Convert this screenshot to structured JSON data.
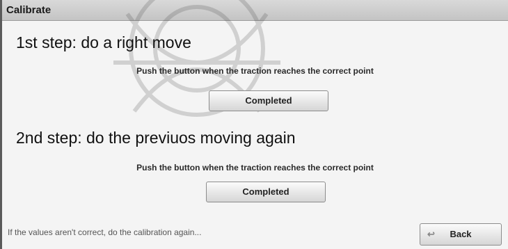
{
  "window": {
    "title": "Calibrate"
  },
  "steps": [
    {
      "heading": "1st step: do a right move",
      "instruction": "Push the button when the traction reaches the correct point",
      "button_label": "Completed"
    },
    {
      "heading": "2nd step: do the previuos moving again",
      "instruction": "Push the button when the traction reaches the correct point",
      "button_label": "Completed"
    }
  ],
  "footer": {
    "note": "If the values aren't correct, do the calibration again...",
    "back_label": "Back",
    "back_icon": "arrow-back-icon"
  },
  "colors": {
    "titlebar": "#cfcfcf",
    "background": "#f4f4f4",
    "button_top": "#fbfbfb",
    "button_bottom": "#d6d6d6"
  }
}
